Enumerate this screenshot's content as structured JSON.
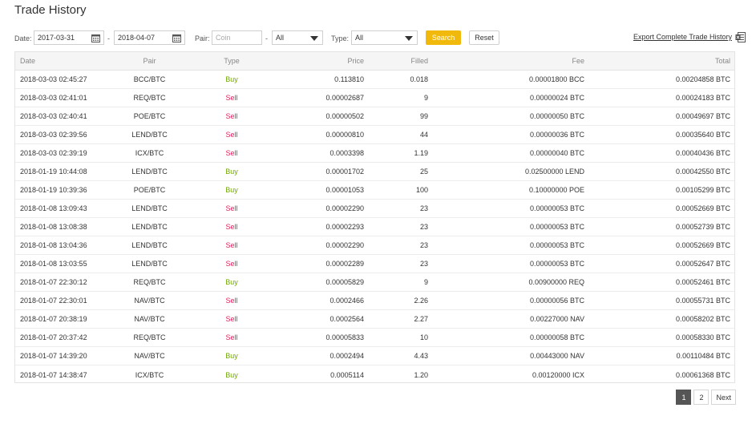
{
  "page": {
    "title": "Trade History"
  },
  "filters": {
    "date_label": "Date:",
    "date_from": "2017-03-31",
    "date_separator": "-",
    "date_to": "2018-04-07",
    "pair_label": "Pair:",
    "coin_placeholder": "Coin",
    "pair_separator": "-",
    "pair_selected": "All",
    "type_label": "Type:",
    "type_selected": "All",
    "search_label": "Search",
    "reset_label": "Reset",
    "export_label": "Export Complete Trade History"
  },
  "colors": {
    "accent": "#f0b90b",
    "buy": "#70a800",
    "sell": "#e0245e"
  },
  "table": {
    "headers": {
      "date": "Date",
      "pair": "Pair",
      "type": "Type",
      "price": "Price",
      "filled": "Filled",
      "fee": "Fee",
      "total": "Total"
    },
    "rows": [
      {
        "date": "2018-03-03 02:45:27",
        "pair": "BCC/BTC",
        "type": "Buy",
        "price": "0.113810",
        "filled": "0.018",
        "fee": "0.00001800 BCC",
        "total": "0.00204858 BTC"
      },
      {
        "date": "2018-03-03 02:41:01",
        "pair": "REQ/BTC",
        "type": "Sell",
        "price": "0.00002687",
        "filled": "9",
        "fee": "0.00000024 BTC",
        "total": "0.00024183 BTC"
      },
      {
        "date": "2018-03-03 02:40:41",
        "pair": "POE/BTC",
        "type": "Sell",
        "price": "0.00000502",
        "filled": "99",
        "fee": "0.00000050 BTC",
        "total": "0.00049697 BTC"
      },
      {
        "date": "2018-03-03 02:39:56",
        "pair": "LEND/BTC",
        "type": "Sell",
        "price": "0.00000810",
        "filled": "44",
        "fee": "0.00000036 BTC",
        "total": "0.00035640 BTC"
      },
      {
        "date": "2018-03-03 02:39:19",
        "pair": "ICX/BTC",
        "type": "Sell",
        "price": "0.0003398",
        "filled": "1.19",
        "fee": "0.00000040 BTC",
        "total": "0.00040436 BTC"
      },
      {
        "date": "2018-01-19 10:44:08",
        "pair": "LEND/BTC",
        "type": "Buy",
        "price": "0.00001702",
        "filled": "25",
        "fee": "0.02500000 LEND",
        "total": "0.00042550 BTC"
      },
      {
        "date": "2018-01-19 10:39:36",
        "pair": "POE/BTC",
        "type": "Buy",
        "price": "0.00001053",
        "filled": "100",
        "fee": "0.10000000 POE",
        "total": "0.00105299 BTC"
      },
      {
        "date": "2018-01-08 13:09:43",
        "pair": "LEND/BTC",
        "type": "Sell",
        "price": "0.00002290",
        "filled": "23",
        "fee": "0.00000053 BTC",
        "total": "0.00052669 BTC"
      },
      {
        "date": "2018-01-08 13:08:38",
        "pair": "LEND/BTC",
        "type": "Sell",
        "price": "0.00002293",
        "filled": "23",
        "fee": "0.00000053 BTC",
        "total": "0.00052739 BTC"
      },
      {
        "date": "2018-01-08 13:04:36",
        "pair": "LEND/BTC",
        "type": "Sell",
        "price": "0.00002290",
        "filled": "23",
        "fee": "0.00000053 BTC",
        "total": "0.00052669 BTC"
      },
      {
        "date": "2018-01-08 13:03:55",
        "pair": "LEND/BTC",
        "type": "Sell",
        "price": "0.00002289",
        "filled": "23",
        "fee": "0.00000053 BTC",
        "total": "0.00052647 BTC"
      },
      {
        "date": "2018-01-07 22:30:12",
        "pair": "REQ/BTC",
        "type": "Buy",
        "price": "0.00005829",
        "filled": "9",
        "fee": "0.00900000 REQ",
        "total": "0.00052461 BTC"
      },
      {
        "date": "2018-01-07 22:30:01",
        "pair": "NAV/BTC",
        "type": "Sell",
        "price": "0.0002466",
        "filled": "2.26",
        "fee": "0.00000056 BTC",
        "total": "0.00055731 BTC"
      },
      {
        "date": "2018-01-07 20:38:19",
        "pair": "NAV/BTC",
        "type": "Sell",
        "price": "0.0002564",
        "filled": "2.27",
        "fee": "0.00227000 NAV",
        "total": "0.00058202 BTC"
      },
      {
        "date": "2018-01-07 20:37:42",
        "pair": "REQ/BTC",
        "type": "Sell",
        "price": "0.00005833",
        "filled": "10",
        "fee": "0.00000058 BTC",
        "total": "0.00058330 BTC"
      },
      {
        "date": "2018-01-07 14:39:20",
        "pair": "NAV/BTC",
        "type": "Buy",
        "price": "0.0002494",
        "filled": "4.43",
        "fee": "0.00443000 NAV",
        "total": "0.00110484 BTC"
      },
      {
        "date": "2018-01-07 14:38:47",
        "pair": "ICX/BTC",
        "type": "Buy",
        "price": "0.0005114",
        "filled": "1.20",
        "fee": "0.00120000 ICX",
        "total": "0.00061368 BTC"
      }
    ]
  },
  "pagination": {
    "pages": [
      "1",
      "2"
    ],
    "current": "1",
    "next_label": "Next"
  }
}
